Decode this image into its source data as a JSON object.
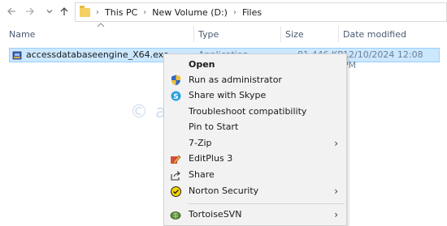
{
  "nav": {
    "path": [
      "This PC",
      "New Volume (D:)",
      "Files"
    ]
  },
  "columns": {
    "name": "Name",
    "type": "Type",
    "size": "Size",
    "date_modified": "Date modified"
  },
  "file": {
    "name": "accessdatabaseengine_X64.exe",
    "type": "Application",
    "size": "81,446 KB",
    "date": "12/10/2024 12:08 PM"
  },
  "watermark": "© aspsnippets.com",
  "context_menu": {
    "items": [
      {
        "label": "Open",
        "icon": "none",
        "submenu": false
      },
      {
        "label": "Run as administrator",
        "icon": "shield-icon",
        "submenu": false
      },
      {
        "label": "Share with Skype",
        "icon": "skype-icon",
        "submenu": false
      },
      {
        "label": "Troubleshoot compatibility",
        "icon": "none",
        "submenu": false
      },
      {
        "label": "Pin to Start",
        "icon": "none",
        "submenu": false
      },
      {
        "label": "7-Zip",
        "icon": "none",
        "submenu": true
      },
      {
        "label": "EditPlus 3",
        "icon": "editplus-icon",
        "submenu": false
      },
      {
        "label": "Share",
        "icon": "share-icon",
        "submenu": false
      },
      {
        "label": "Norton Security",
        "icon": "norton-icon",
        "submenu": true
      },
      {
        "label": "TortoiseSVN",
        "icon": "tortoisesvn-icon",
        "submenu": true
      }
    ]
  },
  "colors": {
    "selection_bg": "#cce8ff",
    "selection_border": "#99d1ff",
    "menu_bg": "#f2f2f2",
    "header_text": "#4a5a72"
  }
}
